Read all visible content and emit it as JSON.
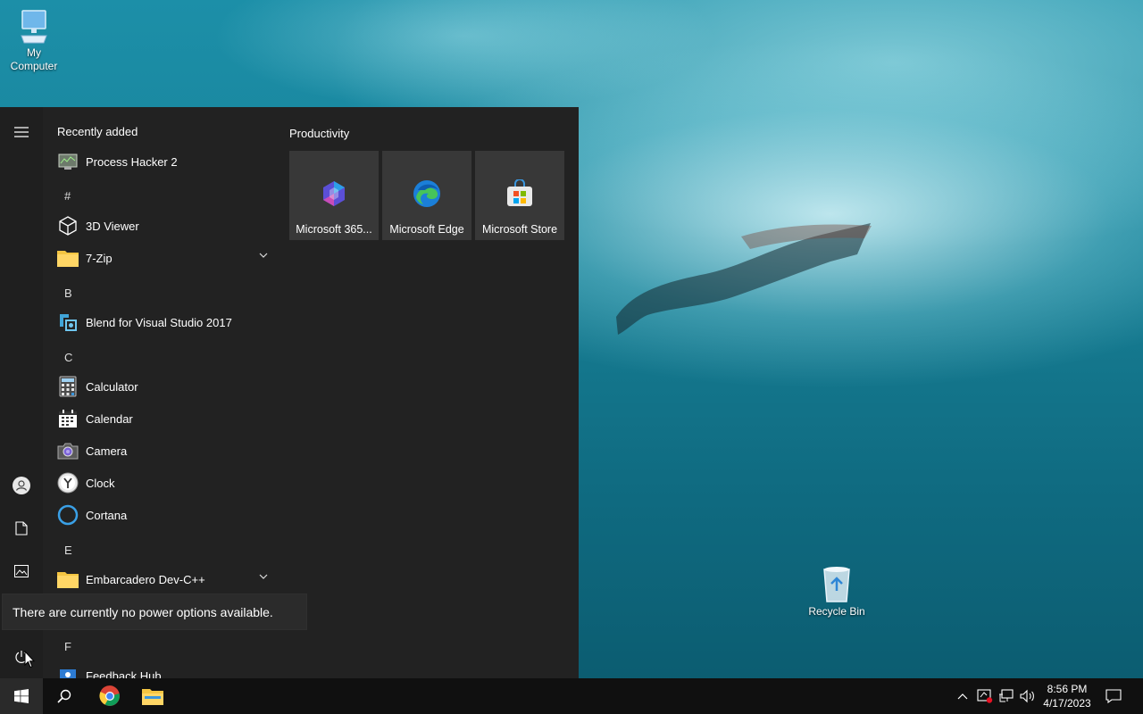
{
  "desktop": {
    "icons": {
      "my_computer": "My\nComputer",
      "recycle_bin": "Recycle Bin"
    }
  },
  "start_menu": {
    "recently_added_label": "Recently added",
    "recent_apps": [
      "Process Hacker 2"
    ],
    "letters": {
      "hash": "#",
      "b": "B",
      "c": "C",
      "e": "E",
      "f": "F"
    },
    "apps": {
      "three_d_viewer": "3D Viewer",
      "seven_zip": "7-Zip",
      "blend": "Blend for Visual Studio 2017",
      "calculator": "Calculator",
      "calendar": "Calendar",
      "camera": "Camera",
      "clock": "Clock",
      "cortana": "Cortana",
      "embarcadero": "Embarcadero Dev-C++",
      "feedback_hub": "Feedback Hub"
    },
    "tile_group_title": "Productivity",
    "tiles": [
      "Microsoft 365...",
      "Microsoft Edge",
      "Microsoft Store"
    ],
    "power_tooltip": "There are currently no power options available."
  },
  "taskbar": {
    "time": "8:56 PM",
    "date": "4/17/2023",
    "pinned": [
      "chrome-icon",
      "file-explorer-icon"
    ]
  },
  "colors": {
    "start_bg": "#222222",
    "tile_bg": "#383838",
    "taskbar_bg": "#101010"
  }
}
